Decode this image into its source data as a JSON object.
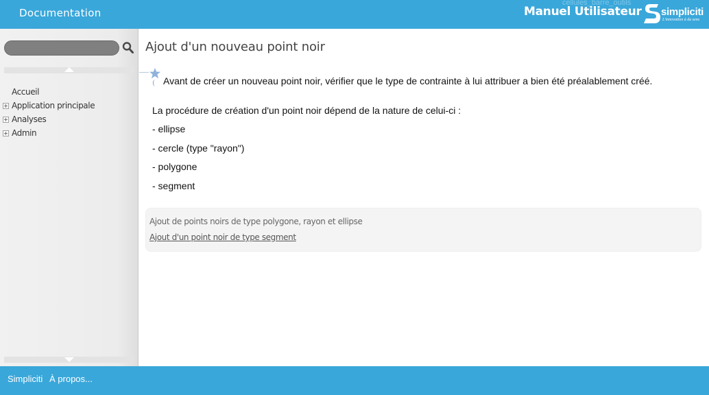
{
  "header": {
    "doc_title": "Documentation",
    "ghost_link": "cellules_barre_outils",
    "manual_title": "Manuel Utilisateur",
    "logo": {
      "word": "simpliciti",
      "tagline": "L'innovation à du sens",
      "icon": "simpliciti-s-logo"
    }
  },
  "sidebar": {
    "search": {
      "value": "",
      "placeholder": "",
      "icon": "search-icon"
    },
    "tree": [
      {
        "label": "Accueil",
        "expandable": false
      },
      {
        "label": "Application principale",
        "expandable": true
      },
      {
        "label": "Analyses",
        "expandable": true
      },
      {
        "label": "Admin",
        "expandable": true
      }
    ]
  },
  "main": {
    "title": "Ajout d'un nouveau point noir",
    "note": "Avant de créer un nouveau point noir, vérifier que le type de contrainte à lui attribuer a bien été préalablement créé.",
    "intro": "La procédure de création d'un point noir dépend de la nature de celui-ci :",
    "bullets": [
      "- ellipse",
      "- cercle (type \"rayon\")",
      "- polygone",
      "- segment"
    ],
    "related": {
      "current": "Ajout de points noirs de type polygone, rayon et ellipse",
      "link": "Ajout d'un point noir de type segment"
    }
  },
  "footer": {
    "links": [
      "Simpliciti",
      "À propos..."
    ]
  },
  "colors": {
    "brand_blue": "#3aa7da",
    "search_field": "#808080",
    "sidebar_bg": "#ececec",
    "related_box_bg": "#f4f4f4",
    "star_icon": "#8fb3d9"
  }
}
